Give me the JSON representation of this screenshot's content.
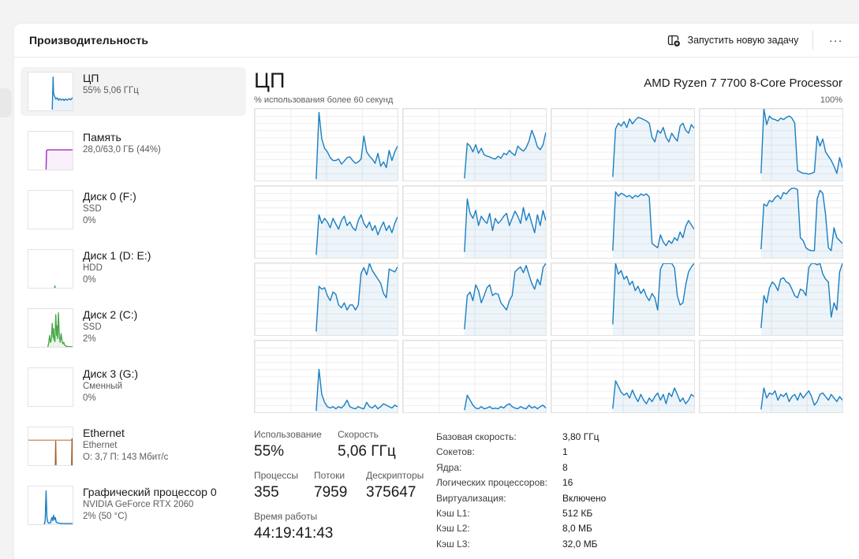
{
  "window": {
    "title": "Производительность",
    "run_new_task_label": "Запустить новую задачу",
    "run_new_task_icon": "window-plus-icon",
    "more_glyph": "...",
    "more_icon": "ellipsis-icon"
  },
  "sidebar": {
    "items": [
      {
        "id": "cpu",
        "title": "ЦП",
        "lines": [
          "55% 5,06 ГГц"
        ],
        "selected": true,
        "chart": {
          "color": "#1b7ec2",
          "fill": "rgba(27,126,194,0.09)",
          "lines": [
            [
              [
                54,
                2
              ],
              [
                56,
                88
              ],
              [
                57,
                45
              ],
              [
                59,
                38
              ],
              [
                62,
                30
              ],
              [
                65,
                33
              ],
              [
                68,
                27
              ],
              [
                71,
                31
              ],
              [
                74,
                27
              ],
              [
                78,
                30
              ],
              [
                81,
                26
              ],
              [
                84,
                30
              ],
              [
                88,
                27
              ],
              [
                92,
                31
              ],
              [
                96,
                28
              ],
              [
                100,
                34
              ]
            ]
          ]
        }
      },
      {
        "id": "memory",
        "title": "Память",
        "lines": [
          "28,0/63,0 ГБ (44%)"
        ],
        "selected": false,
        "chart": {
          "color": "#a32cc4",
          "fill": "rgba(163,44,196,0.07)",
          "lines": [
            [
              [
                40,
                0
              ],
              [
                41,
                50
              ],
              [
                44,
                52
              ],
              [
                100,
                52
              ]
            ]
          ]
        }
      },
      {
        "id": "disk0",
        "title": "Диск 0 (F:)",
        "lines": [
          "SSD",
          "0%"
        ],
        "selected": false,
        "chart": {
          "color": "#53b253",
          "fill": "none",
          "lines": []
        }
      },
      {
        "id": "disk1",
        "title": "Диск 1 (D: E:)",
        "lines": [
          "HDD",
          "0%"
        ],
        "selected": false,
        "chart": {
          "color": "#53b253",
          "fill": "none",
          "lines": [
            [
              [
                59,
                0
              ],
              [
                60,
                5
              ],
              [
                61,
                0
              ]
            ]
          ]
        }
      },
      {
        "id": "disk2",
        "title": "Диск 2 (C:)",
        "lines": [
          "SSD",
          "2%"
        ],
        "selected": false,
        "chart": {
          "color": "#4aa84a",
          "fill": "rgba(80,170,70,0.12)",
          "lines": [
            [
              [
                44,
                0
              ],
              [
                46,
                10
              ],
              [
                48,
                30
              ],
              [
                50,
                12
              ],
              [
                52,
                20
              ],
              [
                54,
                62
              ],
              [
                56,
                25
              ],
              [
                57,
                48
              ],
              [
                58,
                20
              ],
              [
                60,
                14
              ],
              [
                62,
                85
              ],
              [
                64,
                30
              ],
              [
                65,
                55
              ],
              [
                66,
                22
              ],
              [
                68,
                90
              ],
              [
                70,
                28
              ],
              [
                72,
                12
              ],
              [
                74,
                35
              ],
              [
                76,
                18
              ],
              [
                78,
                8
              ],
              [
                80,
                12
              ],
              [
                82,
                5
              ],
              [
                84,
                3
              ],
              [
                86,
                2
              ],
              [
                90,
                1
              ],
              [
                100,
                0
              ]
            ]
          ]
        }
      },
      {
        "id": "disk3",
        "title": "Диск 3 (G:)",
        "lines": [
          "Сменный",
          "0%"
        ],
        "selected": false,
        "chart": {
          "color": "#53b253",
          "fill": "none",
          "lines": []
        }
      },
      {
        "id": "ethernet",
        "title": "Ethernet",
        "lines": [
          "Ethernet",
          "О: 3,7 П: 143 Мбит/с"
        ],
        "selected": false,
        "chart": {
          "color": "#c9946a",
          "fill": "none",
          "lines": [
            [
              [
                0,
                66
              ],
              [
                100,
                66
              ]
            ]
          ],
          "color2": "#a85e28",
          "lines2": [
            [
              [
                61,
                0
              ],
              [
                61.8,
                63
              ],
              [
                62.6,
                0
              ]
            ],
            [
              [
                97.8,
                0
              ],
              [
                98.8,
                70
              ],
              [
                99.6,
                0
              ]
            ]
          ]
        }
      },
      {
        "id": "gpu0",
        "title": "Графический процессор 0",
        "lines": [
          "NVIDIA GeForce RTX 2060",
          "2% (50 °C)"
        ],
        "selected": false,
        "chart": {
          "color": "#1b7ec2",
          "fill": "rgba(27,126,194,0.09)",
          "lines": [
            [
              [
                36,
                0
              ],
              [
                38,
                10
              ],
              [
                40,
                88
              ],
              [
                42,
                18
              ],
              [
                44,
                6
              ],
              [
                46,
                3
              ],
              [
                50,
                4
              ],
              [
                53,
                18
              ],
              [
                55,
                10
              ],
              [
                57,
                24
              ],
              [
                59,
                12
              ],
              [
                61,
                18
              ],
              [
                63,
                6
              ],
              [
                66,
                4
              ],
              [
                70,
                3
              ],
              [
                80,
                2
              ],
              [
                100,
                2
              ]
            ]
          ]
        }
      }
    ]
  },
  "main": {
    "title": "ЦП",
    "processor_name": "AMD Ryzen 7 7700 8-Core Processor",
    "graph_caption": "% использования более 60 секунд",
    "graph_max_label": "100%",
    "stats_left": {
      "usage_label": "Использование",
      "usage_value": "55%",
      "speed_label": "Скорость",
      "speed_value": "5,06 ГГц",
      "processes_label": "Процессы",
      "processes_value": "355",
      "threads_label": "Потоки",
      "threads_value": "7959",
      "handles_label": "Дескрипторы",
      "handles_value": "375647",
      "uptime_label": "Время работы",
      "uptime_value": "44:19:41:43"
    },
    "stats_right": [
      {
        "label": "Базовая скорость:",
        "value": "3,80 ГГц"
      },
      {
        "label": "Сокетов:",
        "value": "1"
      },
      {
        "label": "Ядра:",
        "value": "8"
      },
      {
        "label": "Логических процессоров:",
        "value": "16"
      },
      {
        "label": "Виртуализация:",
        "value": "Включено"
      },
      {
        "label": "Кэш L1:",
        "value": "512 КБ"
      },
      {
        "label": "Кэш L2:",
        "value": "8,0 МБ"
      },
      {
        "label": "Кэш L3:",
        "value": "32,0 МБ"
      }
    ]
  },
  "chart_data": {
    "type": "area",
    "title": "% использования более 60 секунд",
    "ylabel": "% использования",
    "ylim": [
      0,
      100
    ],
    "window_seconds": 60,
    "data_start_pct": 43,
    "grid": true,
    "layout": "4x4 per-logical-processor",
    "line_color": "#1b7ec2",
    "fill_color": "rgba(27,126,194,0.08)",
    "series": [
      {
        "name": "CPU 0",
        "values": [
          2,
          95,
          58,
          45,
          40,
          32,
          28,
          28,
          30,
          23,
          27,
          32,
          33,
          28,
          24,
          26,
          30,
          62,
          40,
          34,
          30,
          24,
          38,
          20,
          26,
          18,
          42,
          28,
          40,
          48
        ]
      },
      {
        "name": "CPU 1",
        "values": [
          3,
          52,
          48,
          40,
          50,
          38,
          45,
          36,
          34,
          33,
          31,
          30,
          34,
          31,
          38,
          36,
          42,
          38,
          35,
          48,
          44,
          41,
          46,
          55,
          70,
          60,
          47,
          43,
          50,
          67
        ]
      },
      {
        "name": "CPU 2",
        "values": [
          5,
          72,
          80,
          76,
          82,
          74,
          86,
          79,
          84,
          88,
          87,
          85,
          83,
          80,
          60,
          54,
          70,
          66,
          74,
          60,
          54,
          66,
          60,
          55,
          76,
          80,
          70,
          66,
          78,
          73
        ]
      },
      {
        "name": "CPU 3",
        "values": [
          10,
          100,
          78,
          90,
          86,
          85,
          83,
          87,
          85,
          88,
          90,
          87,
          80,
          14,
          12,
          10,
          10,
          9,
          10,
          12,
          62,
          48,
          58,
          40,
          34,
          28,
          20,
          10,
          32,
          18
        ]
      },
      {
        "name": "CPU 4",
        "values": [
          4,
          60,
          48,
          55,
          50,
          42,
          55,
          47,
          40,
          52,
          58,
          45,
          50,
          42,
          38,
          52,
          60,
          48,
          42,
          50,
          38,
          45,
          32,
          42,
          50,
          38,
          45,
          35,
          48,
          57
        ]
      },
      {
        "name": "CPU 5",
        "values": [
          8,
          82,
          62,
          55,
          66,
          45,
          58,
          52,
          48,
          62,
          38,
          55,
          48,
          52,
          58,
          62,
          45,
          55,
          65,
          58,
          48,
          70,
          52,
          62,
          48,
          35,
          60,
          45,
          66,
          52
        ]
      },
      {
        "name": "CPU 6",
        "values": [
          10,
          92,
          86,
          90,
          88,
          85,
          87,
          83,
          87,
          85,
          89,
          87,
          89,
          85,
          20,
          17,
          14,
          32,
          22,
          17,
          24,
          20,
          28,
          24,
          36,
          28,
          44,
          52,
          46,
          40
        ]
      },
      {
        "name": "CPU 7",
        "values": [
          12,
          75,
          72,
          80,
          78,
          84,
          87,
          82,
          91,
          89,
          94,
          97,
          97,
          95,
          28,
          24,
          14,
          11,
          10,
          10,
          82,
          94,
          90,
          60,
          14,
          10,
          42,
          28,
          24,
          20
        ]
      },
      {
        "name": "CPU 8",
        "values": [
          5,
          68,
          64,
          66,
          55,
          48,
          60,
          57,
          42,
          38,
          45,
          35,
          42,
          42,
          35,
          42,
          86,
          94,
          84,
          100,
          90,
          84,
          78,
          72,
          58,
          52,
          92,
          90,
          88,
          95
        ]
      },
      {
        "name": "CPU 9",
        "values": [
          8,
          55,
          60,
          48,
          70,
          62,
          45,
          55,
          66,
          70,
          55,
          58,
          57,
          45,
          40,
          35,
          48,
          55,
          88,
          92,
          95,
          87,
          97,
          84,
          72,
          64,
          78,
          70,
          94,
          100
        ]
      },
      {
        "name": "CPU 10",
        "values": [
          15,
          100,
          85,
          90,
          78,
          82,
          70,
          75,
          62,
          68,
          58,
          64,
          54,
          48,
          58,
          52,
          35,
          92,
          100,
          100,
          100,
          100,
          94,
          55,
          42,
          45,
          70,
          88,
          95,
          100
        ]
      },
      {
        "name": "CPU 11",
        "values": [
          10,
          55,
          45,
          66,
          74,
          70,
          62,
          78,
          80,
          74,
          72,
          64,
          55,
          52,
          64,
          62,
          55,
          94,
          100,
          100,
          98,
          100,
          85,
          78,
          74,
          25,
          45,
          35,
          88,
          100
        ]
      },
      {
        "name": "CPU 12",
        "values": [
          2,
          60,
          25,
          14,
          8,
          6,
          8,
          5,
          8,
          6,
          10,
          17,
          8,
          6,
          5,
          8,
          6,
          5,
          14,
          8,
          6,
          10,
          5,
          8,
          12,
          10,
          8,
          6,
          10,
          8
        ]
      },
      {
        "name": "CPU 13",
        "values": [
          3,
          24,
          17,
          10,
          6,
          5,
          8,
          5,
          6,
          8,
          5,
          6,
          5,
          8,
          6,
          10,
          12,
          8,
          6,
          5,
          8,
          6,
          5,
          10,
          6,
          8,
          5,
          8,
          10,
          6
        ]
      },
      {
        "name": "CPU 14",
        "values": [
          5,
          44,
          36,
          28,
          24,
          27,
          20,
          31,
          22,
          15,
          25,
          17,
          12,
          20,
          15,
          22,
          27,
          17,
          25,
          12,
          27,
          22,
          34,
          25,
          15,
          20,
          12,
          17,
          25,
          22
        ]
      },
      {
        "name": "CPU 15",
        "values": [
          4,
          34,
          20,
          27,
          25,
          30,
          17,
          25,
          22,
          27,
          15,
          22,
          25,
          17,
          27,
          20,
          25,
          30,
          22,
          10,
          15,
          25,
          27,
          22,
          17,
          25,
          20,
          15,
          22,
          17
        ]
      }
    ]
  }
}
